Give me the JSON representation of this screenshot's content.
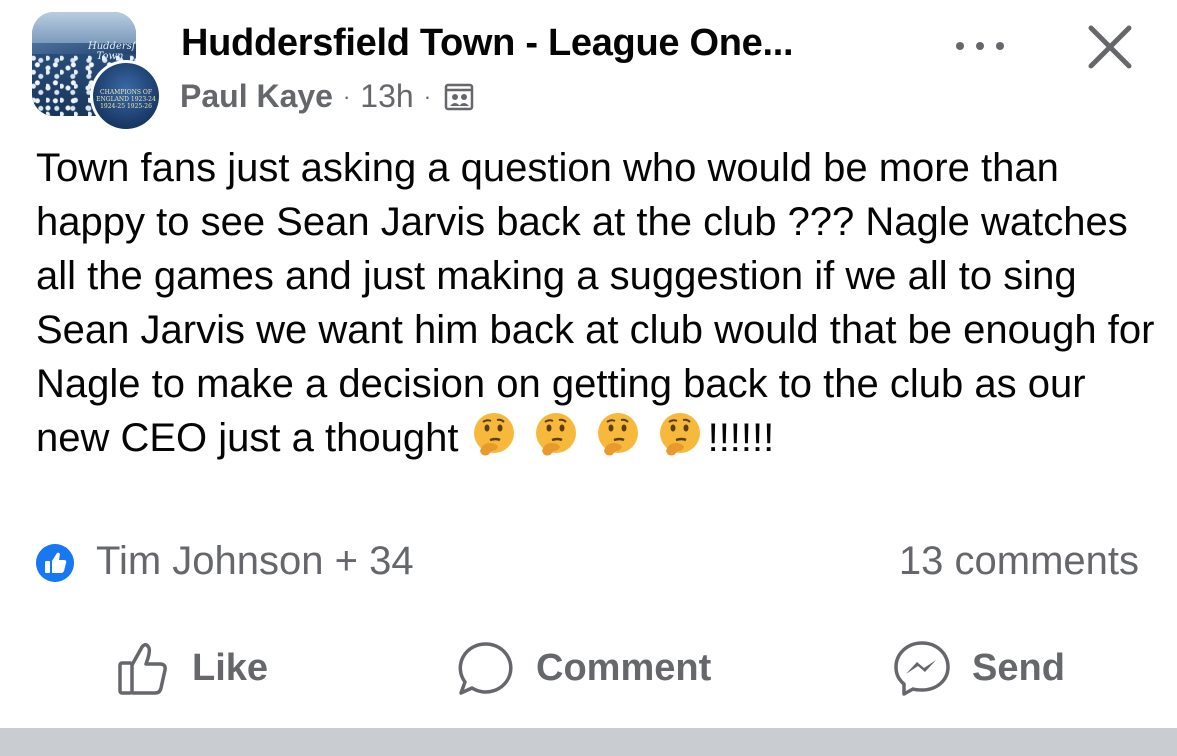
{
  "header": {
    "group_name": "Huddersfield Town - League One...",
    "group_avatar_text": "Huddersfield Town",
    "badge_text": "CHAMPIONS OF ENGLAND 1923-24 1924-25 1925-26",
    "author": "Paul Kaye",
    "time": "13h",
    "separator": "·",
    "more_icon": "more-horizontal-icon",
    "close_icon": "close-icon",
    "privacy_icon": "group-members-icon"
  },
  "post": {
    "text_part1": "Town fans just asking a question who would be more than happy to see Sean Jarvis back at the club ??? Nagle watches all the games and just making a suggestion if we all to sing Sean Jarvis we want him back at club would that be enough for Nagle to make a decision on getting back to the club as our new CEO just a thought ",
    "emojis": [
      "thinking-face",
      "thinking-face",
      "thinking-face",
      "thinking-face"
    ],
    "text_part2": "!!!!!!"
  },
  "reactions": {
    "icon": "like-reaction-icon",
    "summary": "Tim Johnson + 34",
    "comments": "13 comments"
  },
  "actions": {
    "like_label": "Like",
    "comment_label": "Comment",
    "send_label": "Send"
  },
  "colors": {
    "text": "#050505",
    "secondary": "#65676b",
    "facebook_blue": "#1877f2",
    "emoji_yellow": "#f6b93b",
    "divider": "#c9ccd1"
  }
}
